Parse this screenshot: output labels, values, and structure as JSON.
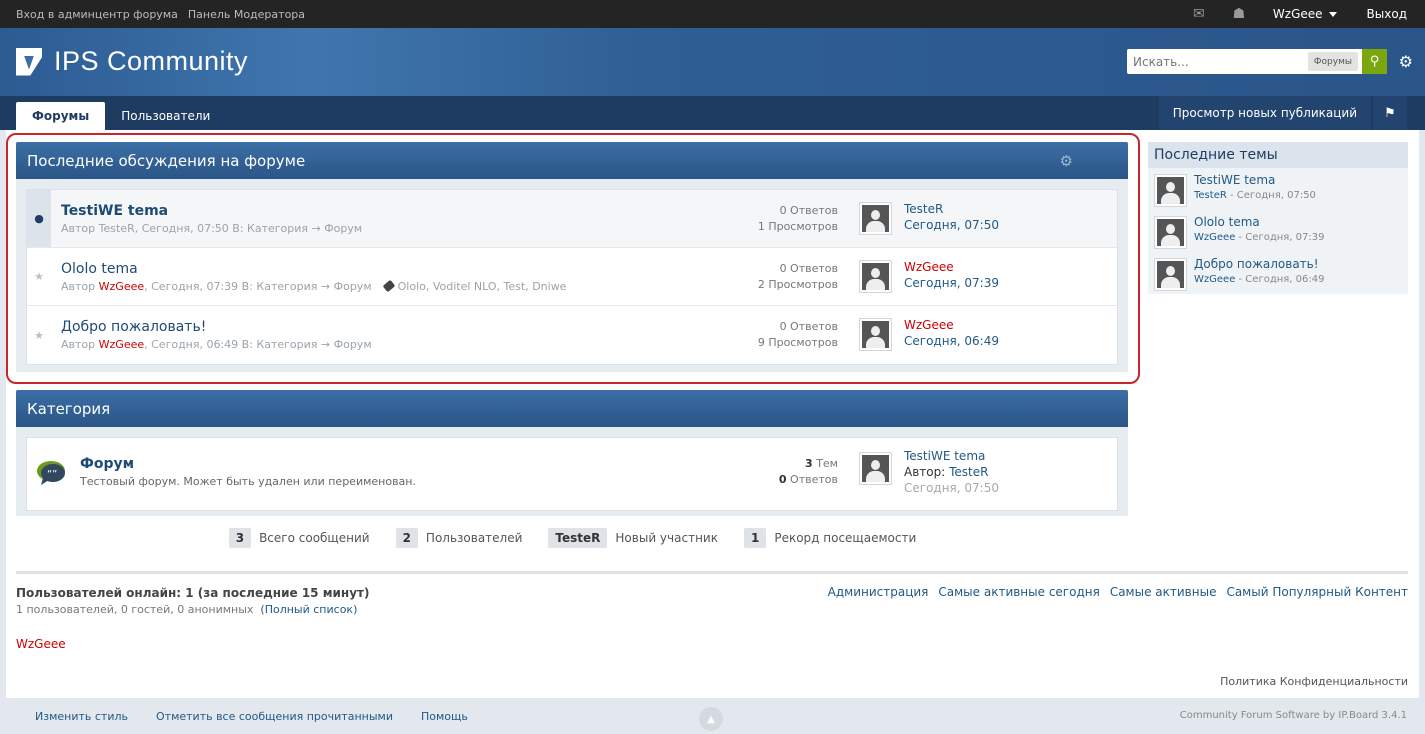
{
  "topbar": {
    "links": [
      "Вход в админцентр форума",
      "Панель Модератора"
    ],
    "username": "WzGeee",
    "logout": "Выход"
  },
  "header": {
    "logo_text": "IPS Community",
    "search_placeholder": "Искать...",
    "search_scope": "Форумы"
  },
  "nav": {
    "tabs": [
      {
        "label": "Форумы",
        "active": true
      },
      {
        "label": "Пользователи",
        "active": false
      }
    ],
    "new_posts": "Просмотр новых публикаций"
  },
  "recent": {
    "title": "Последние обсуждения на форуме",
    "topics": [
      {
        "title": "TestiWE tema",
        "unread": true,
        "author_prefix": "Автор",
        "author": "TesteR",
        "time_in": ", Сегодня, 07:50 В: Категория → Форум",
        "tags": "",
        "replies": "0 Ответов",
        "views": "1 Просмотров",
        "last_user": "TesteR",
        "last_time": "Сегодня, 07:50"
      },
      {
        "title": "Ololo tema",
        "unread": false,
        "author_prefix": "Автор",
        "author": "WzGeee",
        "time_in": ", Сегодня, 07:39 В: Категория → Форум",
        "tags": "Ololo, Voditel NLO, Test, Dniwe",
        "replies": "0 Ответов",
        "views": "2 Просмотров",
        "last_user": "WzGeee",
        "last_time": "Сегодня, 07:39"
      },
      {
        "title": "Добро пожаловать!",
        "unread": false,
        "author_prefix": "Автор",
        "author": "WzGeee",
        "time_in": ", Сегодня, 06:49 В: Категория → Форум",
        "tags": "",
        "replies": "0 Ответов",
        "views": "9 Просмотров",
        "last_user": "WzGeee",
        "last_time": "Сегодня, 06:49"
      }
    ]
  },
  "category": {
    "title": "Категория",
    "forum": {
      "title": "Форум",
      "desc": "Тестовый форум. Может быть удален или переименован.",
      "topics_num": "3",
      "topics_label": " Тем",
      "replies_num": "0",
      "replies_label": " Ответов",
      "last_title": "TestiWE tema",
      "last_by_prefix": "Автор: ",
      "last_by": "TesteR",
      "last_time": "Сегодня, 07:50"
    }
  },
  "sidebar": {
    "title": "Последние темы",
    "items": [
      {
        "title": "TestiWE tema",
        "user": "TesteR",
        "time": " - Сегодня, 07:50"
      },
      {
        "title": "Ololo tema",
        "user": "WzGeee",
        "time": " - Сегодня, 07:39"
      },
      {
        "title": "Добро пожаловать!",
        "user": "WzGeee",
        "time": " - Сегодня, 06:49"
      }
    ]
  },
  "stats": [
    {
      "value": "3",
      "label": "Всего сообщений"
    },
    {
      "value": "2",
      "label": "Пользователей"
    },
    {
      "value": "TesteR",
      "label": "Новый участник"
    },
    {
      "value": "1",
      "label": "Рекорд посещаемости"
    }
  ],
  "online": {
    "heading": "Пользователей онлайн: 1 (за последние 15 минут)",
    "sub": "1 пользователей, 0 гостей, 0 анонимных",
    "full_list": "(Полный список)",
    "links": [
      "Администрация",
      "Самые активные сегодня",
      "Самые активные",
      "Самый Популярный Контент"
    ],
    "user": "WzGeee"
  },
  "privacy": "Политика Конфиденциальности",
  "footer": {
    "links": [
      "Изменить стиль",
      "Отметить все сообщения прочитанными",
      "Помощь"
    ],
    "copyright": "Community Forum Software by IP.Board 3.4.1"
  },
  "colors": {
    "header": "#2f5f94",
    "nav": "#1e3b62",
    "accent_green": "#7ba60d",
    "highlight": "#c7272c",
    "username_red": "#cc0000"
  }
}
